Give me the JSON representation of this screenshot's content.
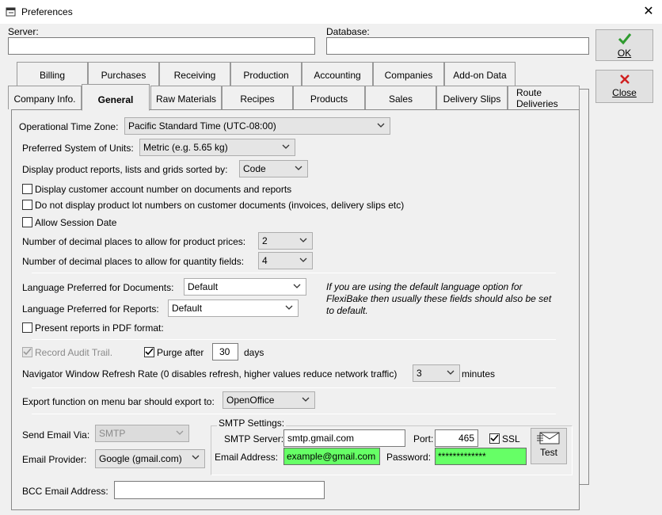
{
  "window": {
    "title": "Preferences"
  },
  "top": {
    "server_label": "Server:",
    "server_value": "",
    "database_label": "Database:",
    "database_value": ""
  },
  "buttons": {
    "ok_label": "OK",
    "close_label": "Close",
    "test_label": "Test"
  },
  "tabs_row1": [
    {
      "label": "Billing"
    },
    {
      "label": "Purchases"
    },
    {
      "label": "Receiving"
    },
    {
      "label": "Production"
    },
    {
      "label": "Accounting"
    },
    {
      "label": "Companies"
    },
    {
      "label": "Add-on Data"
    }
  ],
  "tabs_row2": [
    {
      "label": "Company Info."
    },
    {
      "label": "General"
    },
    {
      "label": "Raw Materials"
    },
    {
      "label": "Recipes"
    },
    {
      "label": "Products"
    },
    {
      "label": "Sales"
    },
    {
      "label": "Delivery Slips"
    },
    {
      "label": "Route Deliveries"
    }
  ],
  "general": {
    "timezone_label": "Operational Time Zone:",
    "timezone_value": "Pacific Standard Time (UTC-08:00)",
    "units_label": "Preferred System of Units:",
    "units_value": "Metric (e.g. 5.65 kg)",
    "sort_label": "Display product reports, lists and grids sorted by:",
    "sort_value": "Code",
    "chk_account_number": "Display customer account number on documents and reports",
    "chk_lot_numbers": "Do not display product lot numbers on customer documents (invoices, delivery slips etc)",
    "chk_session_date": "Allow Session Date",
    "price_decimals_label": "Number of decimal places to allow for product prices:",
    "price_decimals_value": "2",
    "qty_decimals_label": "Number of decimal places to allow for quantity fields:",
    "qty_decimals_value": "4",
    "lang_docs_label": "Language Preferred for Documents:",
    "lang_docs_value": "Default",
    "lang_reports_label": "Language Preferred for Reports:",
    "lang_reports_value": "Default",
    "lang_note": "If you are using the default language option for FlexiBake then usually these fields should also be set to default.",
    "chk_pdf": "Present reports in PDF format:",
    "chk_audit": "Record Audit Trail.",
    "purge_label": "Purge after",
    "purge_value": "30",
    "purge_unit": "days",
    "refresh_label": "Navigator Window Refresh Rate (0 disables refresh, higher values reduce network traffic)",
    "refresh_value": "3",
    "refresh_unit": "minutes",
    "export_label": "Export function on menu bar should export to:",
    "export_value": "OpenOffice",
    "send_email_label": "Send Email Via:",
    "send_email_value": "SMTP",
    "provider_label": "Email Provider:",
    "provider_value": "Google (gmail.com)",
    "smtp_group": "SMTP Settings:",
    "smtp_server_label": "SMTP Server:",
    "smtp_server_value": "smtp.gmail.com",
    "port_label": "Port:",
    "port_value": "465",
    "ssl_label": "SSL",
    "email_address_label": "Email Address:",
    "email_address_value": "example@gmail.com",
    "password_label": "Password:",
    "password_value": "*************",
    "bcc_label": "BCC Email Address:",
    "bcc_value": ""
  },
  "colors": {
    "accent_green": "#66ff66",
    "ok_check": "#2e9b2e",
    "close_x": "#d02020"
  }
}
